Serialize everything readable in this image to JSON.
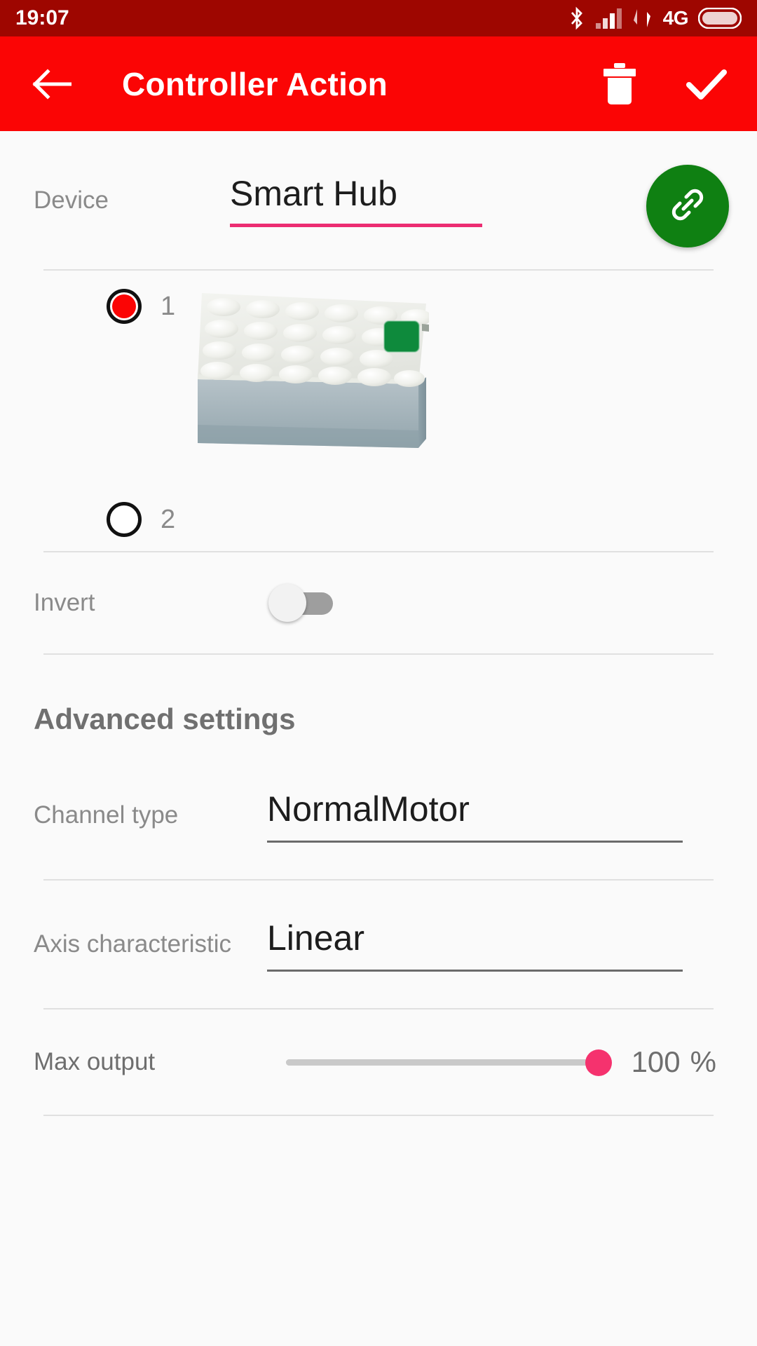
{
  "status_bar": {
    "clock": "19:07",
    "network_label": "4G",
    "icons": [
      "bluetooth-icon",
      "cellular-signal-icon",
      "data-transfer-icon",
      "battery-icon"
    ]
  },
  "app_bar": {
    "title": "Controller Action",
    "back_icon": "back-arrow-icon",
    "delete_icon": "trash-icon",
    "confirm_icon": "check-icon"
  },
  "device": {
    "label": "Device",
    "value": "Smart Hub",
    "link_icon": "link-icon",
    "accent_color": "#EC2D72",
    "fab_color": "#0F8012"
  },
  "ports": {
    "options": [
      {
        "label": "1",
        "selected": true
      },
      {
        "label": "2",
        "selected": false
      }
    ],
    "hub_image_alt": "lego-smart-hub"
  },
  "invert": {
    "label": "Invert",
    "value": "off"
  },
  "advanced": {
    "heading": "Advanced settings",
    "channel_type": {
      "label": "Channel type",
      "value": "NormalMotor"
    },
    "axis_characteristic": {
      "label": "Axis characteristic",
      "value": "Linear"
    },
    "max_output": {
      "label": "Max output",
      "value": "100",
      "unit": "%",
      "percent": 100,
      "thumb_color": "#F5326E"
    }
  }
}
